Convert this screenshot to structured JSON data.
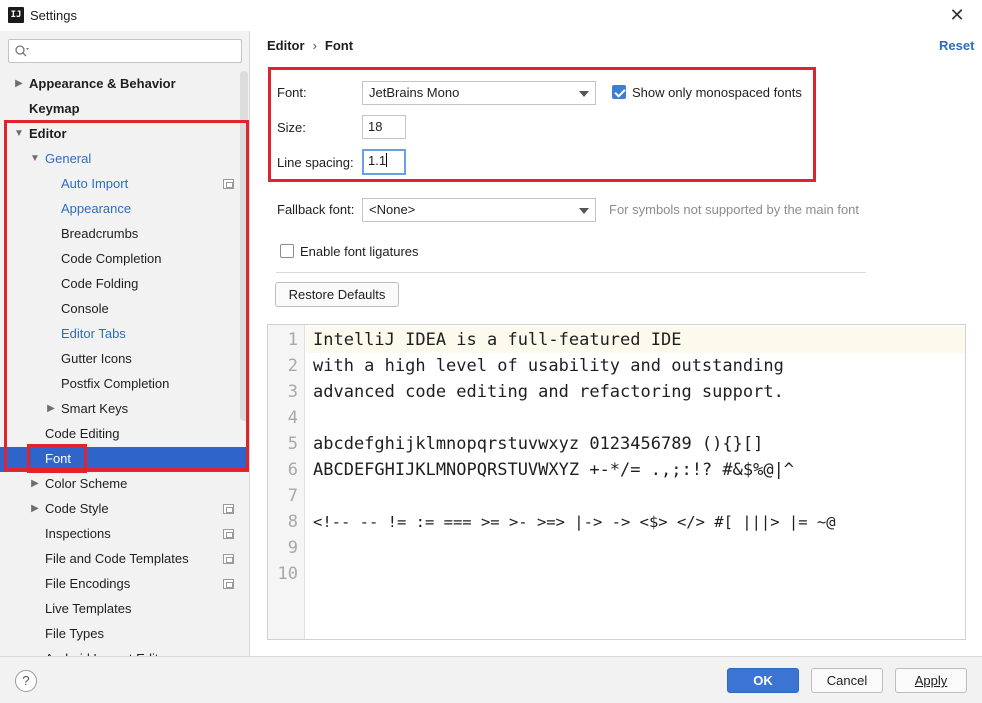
{
  "window": {
    "title": "Settings",
    "app_icon_text": "IJ"
  },
  "search": {
    "placeholder": ""
  },
  "breadcrumb": {
    "parent": "Editor",
    "separator": "›",
    "current": "Font"
  },
  "reset_label": "Reset",
  "sidebar": {
    "items": [
      {
        "label": "Appearance & Behavior"
      },
      {
        "label": "Keymap"
      },
      {
        "label": "Editor"
      },
      {
        "label": "General"
      },
      {
        "label": "Auto Import"
      },
      {
        "label": "Appearance"
      },
      {
        "label": "Breadcrumbs"
      },
      {
        "label": "Code Completion"
      },
      {
        "label": "Code Folding"
      },
      {
        "label": "Console"
      },
      {
        "label": "Editor Tabs"
      },
      {
        "label": "Gutter Icons"
      },
      {
        "label": "Postfix Completion"
      },
      {
        "label": "Smart Keys"
      },
      {
        "label": "Code Editing"
      },
      {
        "label": "Font"
      },
      {
        "label": "Color Scheme"
      },
      {
        "label": "Code Style"
      },
      {
        "label": "Inspections"
      },
      {
        "label": "File and Code Templates"
      },
      {
        "label": "File Encodings"
      },
      {
        "label": "Live Templates"
      },
      {
        "label": "File Types"
      },
      {
        "label": "Android Layout Editor"
      }
    ]
  },
  "font_settings": {
    "font_label": "Font:",
    "font_value": "JetBrains Mono",
    "monospaced_label": "Show only monospaced fonts",
    "monospaced_checked": true,
    "size_label": "Size:",
    "size_value": "18",
    "line_spacing_label": "Line spacing:",
    "line_spacing_value": "1.1",
    "fallback_label": "Fallback font:",
    "fallback_value": "<None>",
    "fallback_hint": "For symbols not supported by the main font",
    "ligatures_label": "Enable font ligatures",
    "ligatures_checked": false,
    "restore_label": "Restore Defaults"
  },
  "preview": {
    "line_numbers": [
      "1",
      "2",
      "3",
      "4",
      "5",
      "6",
      "7",
      "8",
      "9",
      "10"
    ],
    "lines": [
      "IntelliJ IDEA is a full-featured IDE",
      "with a high level of usability and outstanding",
      "advanced code editing and refactoring support.",
      "",
      "abcdefghijklmnopqrstuvwxyz 0123456789 (){}[]",
      "ABCDEFGHIJKLMNOPQRSTUVWXYZ +-*/= .,;:!? #&$%@|^",
      "",
      "<!-- -- != := === >= >- >=> |-> -> <$> </> #[ |||> |= ~@",
      "",
      ""
    ]
  },
  "footer": {
    "help_label": "?",
    "ok_label": "OK",
    "cancel_label": "Cancel",
    "apply_label": "Apply"
  },
  "colors": {
    "accent": "#2f65ca",
    "link": "#2d6dbf",
    "highlight_box": "#e0242e"
  }
}
